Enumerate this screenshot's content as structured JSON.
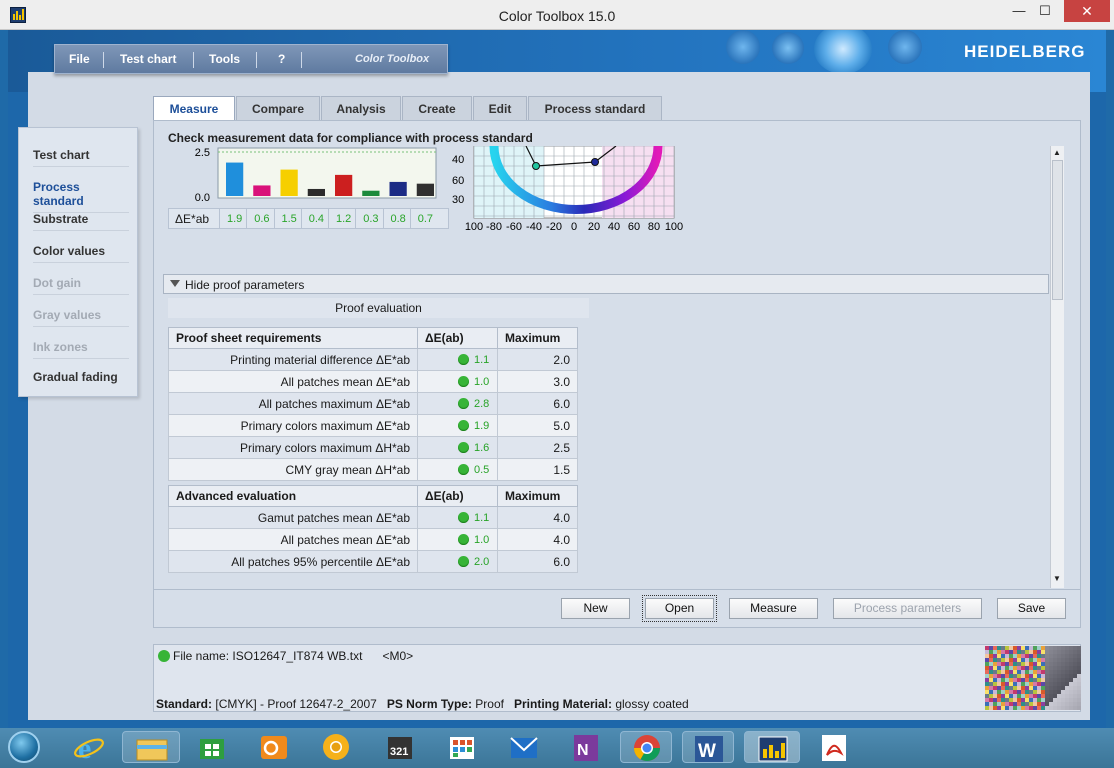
{
  "window": {
    "title": "Color Toolbox 15.0",
    "minimize": "—",
    "maximize": "☐",
    "close": "✕"
  },
  "menu": {
    "items": [
      "File",
      "Test chart",
      "Tools",
      "?"
    ],
    "brand": "Color Toolbox"
  },
  "logo": "HEIDELBERG",
  "sidebar": {
    "items": [
      {
        "label": "Test chart",
        "state": "normal"
      },
      {
        "label": "Process standard",
        "state": "selected"
      },
      {
        "label": "Substrate",
        "state": "normal"
      },
      {
        "label": "Color values",
        "state": "normal"
      },
      {
        "label": "Dot gain",
        "state": "disabled"
      },
      {
        "label": "Gray values",
        "state": "disabled"
      },
      {
        "label": "Ink zones",
        "state": "disabled"
      },
      {
        "label": "Gradual fading",
        "state": "normal"
      }
    ]
  },
  "tabs": [
    {
      "label": "Measure",
      "active": true
    },
    {
      "label": "Compare",
      "active": false
    },
    {
      "label": "Analysis",
      "active": false
    },
    {
      "label": "Create",
      "active": false
    },
    {
      "label": "Edit",
      "active": false
    },
    {
      "label": "Process standard",
      "active": false
    }
  ],
  "panel": {
    "headline": "Check measurement data for compliance with process standard",
    "toggle_label": "Hide proof parameters",
    "proof_title": "Proof evaluation"
  },
  "chart_data": [
    {
      "type": "bar",
      "categories": [
        "C",
        "M",
        "Y",
        "K",
        "R",
        "G",
        "B",
        "CMY"
      ],
      "values": [
        1.9,
        0.6,
        1.5,
        0.4,
        1.2,
        0.3,
        0.8,
        0.7
      ],
      "colors": [
        "#1f8fdc",
        "#d9127a",
        "#f6cf00",
        "#2b2b2b",
        "#cc1f1f",
        "#1c8a3c",
        "#1c2c85",
        "#303030"
      ],
      "ylim": [
        0.0,
        2.5
      ],
      "yticks": [
        "2.5",
        "0.0"
      ],
      "row_label": "ΔE*ab",
      "row_values": [
        "1.9",
        "0.6",
        "1.5",
        "0.4",
        "1.2",
        "0.3",
        "0.8",
        "0.7"
      ],
      "grid": true
    },
    {
      "type": "scatter",
      "xticks": [
        "100",
        "-80",
        "-60",
        "-40",
        "-20",
        "0",
        "20",
        "40",
        "60",
        "80",
        "100"
      ],
      "yticks": [
        "40",
        "60",
        "30"
      ],
      "xlim": [
        -100,
        100
      ],
      "grid": true
    }
  ],
  "proof_table": {
    "headers": [
      "Proof sheet requirements",
      "ΔE(ab)",
      "Maximum"
    ],
    "rows": [
      {
        "name": "Printing material difference ΔE*ab",
        "value": "1.1",
        "max": "2.0"
      },
      {
        "name": "All patches mean ΔE*ab",
        "value": "1.0",
        "max": "3.0"
      },
      {
        "name": "All patches maximum ΔE*ab",
        "value": "2.8",
        "max": "6.0"
      },
      {
        "name": "Primary colors maximum ΔE*ab",
        "value": "1.9",
        "max": "5.0"
      },
      {
        "name": "Primary colors maximum ΔH*ab",
        "value": "1.6",
        "max": "2.5"
      },
      {
        "name": "CMY gray mean ΔH*ab",
        "value": "0.5",
        "max": "1.5"
      }
    ]
  },
  "advanced_table": {
    "headers": [
      "Advanced evaluation",
      "ΔE(ab)",
      "Maximum"
    ],
    "rows": [
      {
        "name": "Gamut patches mean ΔE*ab",
        "value": "1.1",
        "max": "4.0"
      },
      {
        "name": "All patches mean ΔE*ab",
        "value": "1.0",
        "max": "4.0"
      },
      {
        "name": "All patches 95% percentile ΔE*ab",
        "value": "2.0",
        "max": "6.0"
      }
    ]
  },
  "buttons": {
    "new": "New",
    "open": "Open",
    "measure": "Measure",
    "process_params": "Process parameters",
    "save": "Save"
  },
  "status": {
    "file_label": "File name: ISO12647_IT874 WB.txt",
    "mode": "<M0>",
    "standard_label": "Standard:",
    "standard_value": "[CMYK] - Proof 12647-2_2007",
    "norm_label": "PS Norm Type:",
    "norm_value": "Proof",
    "material_label": "Printing Material:",
    "material_value": "glossy coated"
  },
  "taskbar": {
    "icons": [
      "start-orb-icon",
      "internet-explorer-icon",
      "file-explorer-icon",
      "store-icon",
      "outlook-icon",
      "chrome-canary-icon",
      "video-player-icon",
      "apps-icon",
      "mail-icon",
      "onenote-icon",
      "chrome-icon",
      "word-icon",
      "color-toolbox-icon",
      "acrobat-icon"
    ]
  }
}
